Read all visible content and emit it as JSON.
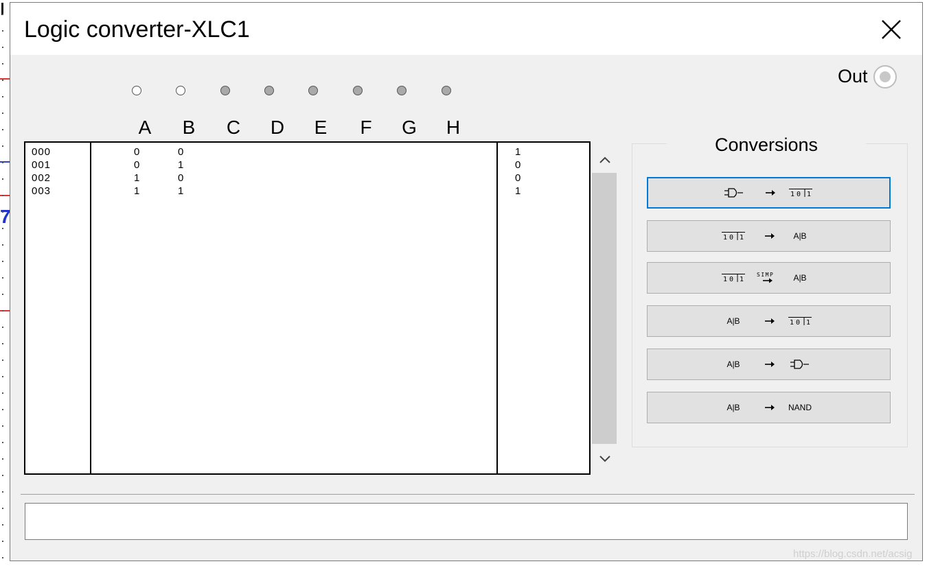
{
  "window": {
    "title": "Logic converter-XLC1",
    "close_icon": "close-x-icon"
  },
  "inputs": [
    {
      "letter": "A",
      "state": "white"
    },
    {
      "letter": "B",
      "state": "white"
    },
    {
      "letter": "C",
      "state": "grey"
    },
    {
      "letter": "D",
      "state": "grey"
    },
    {
      "letter": "E",
      "state": "grey"
    },
    {
      "letter": "F",
      "state": "grey"
    },
    {
      "letter": "G",
      "state": "grey"
    },
    {
      "letter": "H",
      "state": "grey"
    }
  ],
  "output": {
    "label": "Out"
  },
  "truth_table": {
    "rows": [
      {
        "num": "000",
        "a": "0",
        "b": "0",
        "out": "1"
      },
      {
        "num": "001",
        "a": "0",
        "b": "1",
        "out": "0"
      },
      {
        "num": "002",
        "a": "1",
        "b": "0",
        "out": "0"
      },
      {
        "num": "003",
        "a": "1",
        "b": "1",
        "out": "1"
      }
    ]
  },
  "conversions": {
    "title": "Conversions",
    "buttons": [
      {
        "name": "circuit-to-truth-table",
        "from": "gate",
        "op": "arrow",
        "to": "101"
      },
      {
        "name": "truth-table-to-expression",
        "from": "101",
        "op": "arrow",
        "to": "A|B"
      },
      {
        "name": "truth-table-to-simplified-expression",
        "from": "101",
        "op": "SIMP",
        "to": "A|B"
      },
      {
        "name": "expression-to-truth-table",
        "from": "A|B",
        "op": "arrow",
        "to": "101"
      },
      {
        "name": "expression-to-circuit",
        "from": "A|B",
        "op": "arrow",
        "to": "gate"
      },
      {
        "name": "expression-to-nand",
        "from": "A|B",
        "op": "arrow",
        "to": "NAND"
      }
    ]
  },
  "expression": {
    "value": ""
  },
  "watermark": "https://blog.csdn.net/acsig"
}
